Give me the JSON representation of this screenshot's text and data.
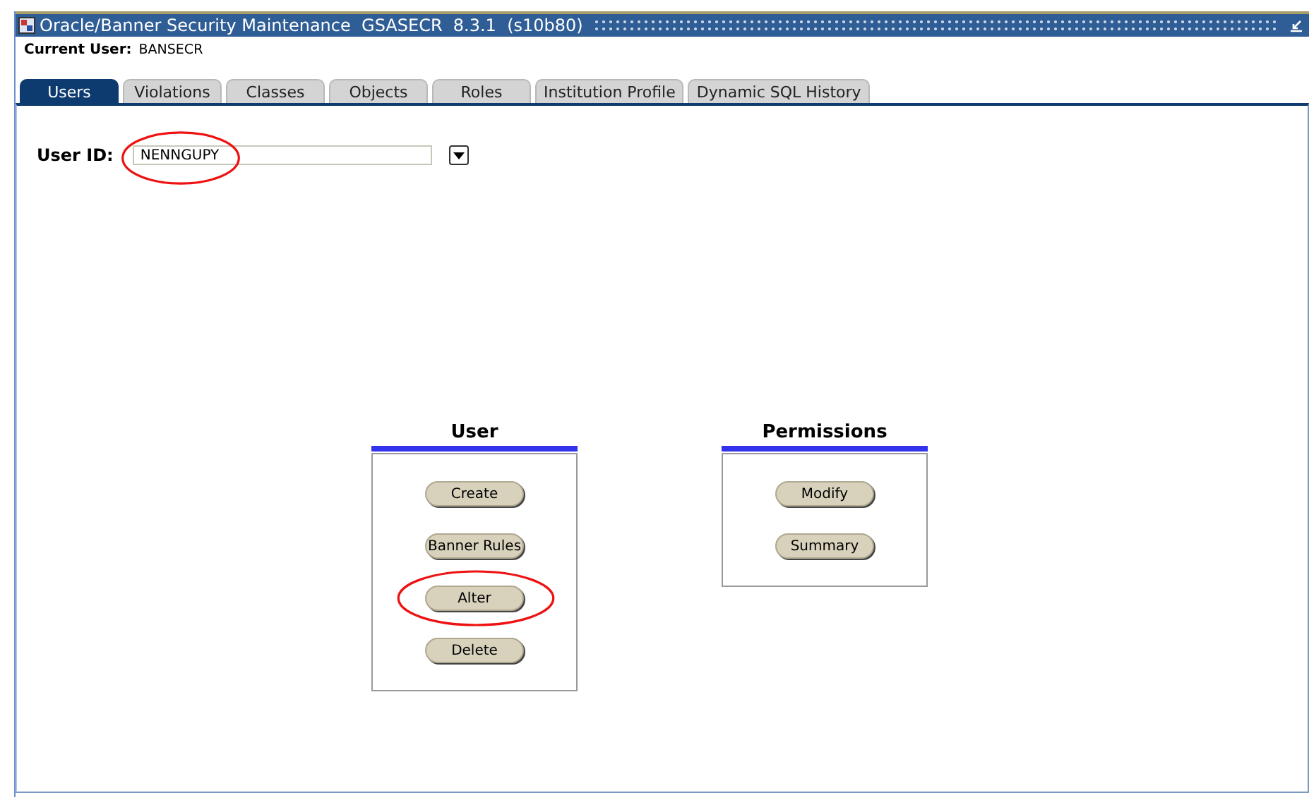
{
  "window": {
    "title": "Oracle/Banner Security Maintenance  GSASECR  8.3.1  (s10b80)"
  },
  "current_user": {
    "label": "Current User:",
    "value": "BANSECR"
  },
  "tabs": [
    {
      "label": "Users",
      "selected": true
    },
    {
      "label": "Violations",
      "selected": false
    },
    {
      "label": "Classes",
      "selected": false
    },
    {
      "label": "Objects",
      "selected": false
    },
    {
      "label": "Roles",
      "selected": false
    },
    {
      "label": "Institution Profile",
      "selected": false
    },
    {
      "label": "Dynamic SQL History",
      "selected": false
    }
  ],
  "user_id": {
    "label": "User ID:",
    "value": "NENNGUPY",
    "highlighted": true
  },
  "groups": [
    {
      "title": "User",
      "buttons": [
        {
          "label": "Create",
          "highlighted": false
        },
        {
          "label": "Banner Rules",
          "highlighted": false
        },
        {
          "label": "Alter",
          "highlighted": true
        },
        {
          "label": "Delete",
          "highlighted": false
        }
      ]
    },
    {
      "title": "Permissions",
      "buttons": [
        {
          "label": "Modify",
          "highlighted": false
        },
        {
          "label": "Summary",
          "highlighted": false
        }
      ]
    }
  ]
}
